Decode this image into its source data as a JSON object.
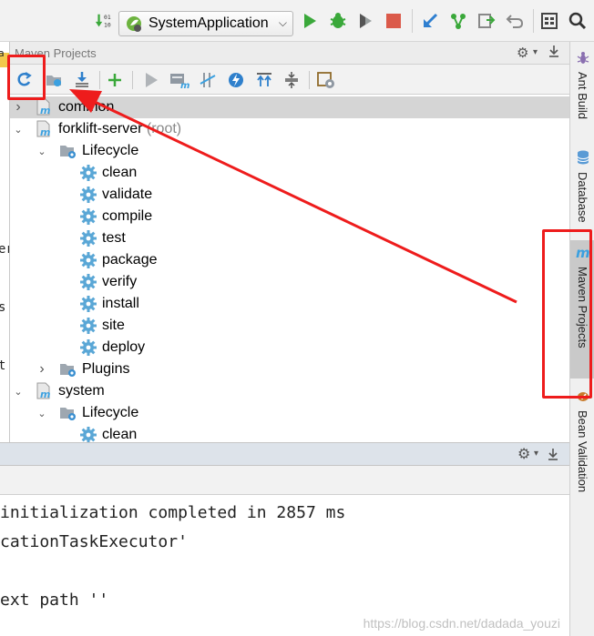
{
  "toolbar": {
    "run_config": "SystemApplication",
    "icons": [
      "sort-01-icon",
      "run-icon",
      "debug-icon",
      "coverage-icon",
      "stop-icon",
      "vcs-update-icon",
      "vcs-branch-icon",
      "vcs-compare-icon",
      "undo-icon",
      "project-structure-icon",
      "search-icon"
    ]
  },
  "left_edge": {
    "fragments": [
      "a",
      "er",
      "s",
      "t"
    ]
  },
  "maven": {
    "title": "Maven Projects",
    "toolbar_icons": [
      "reimport-icon",
      "generate-sources-icon",
      "download-icon",
      "add-icon",
      "run-maven-icon",
      "execute-goal-icon",
      "toggle-offline-icon",
      "skip-tests-icon",
      "show-dependencies-icon",
      "collapse-all-icon",
      "settings-icon"
    ],
    "tree": [
      {
        "label": "common",
        "suffix": "",
        "level": 0,
        "type": "module",
        "expanded": false,
        "selected": true
      },
      {
        "label": "forklift-server",
        "suffix": " (root)",
        "level": 0,
        "type": "module",
        "expanded": true,
        "selected": false
      },
      {
        "label": "Lifecycle",
        "suffix": "",
        "level": 1,
        "type": "folder",
        "expanded": true,
        "selected": false
      },
      {
        "label": "clean",
        "suffix": "",
        "level": 2,
        "type": "goal",
        "selected": false
      },
      {
        "label": "validate",
        "suffix": "",
        "level": 2,
        "type": "goal",
        "selected": false
      },
      {
        "label": "compile",
        "suffix": "",
        "level": 2,
        "type": "goal",
        "selected": false
      },
      {
        "label": "test",
        "suffix": "",
        "level": 2,
        "type": "goal",
        "selected": false
      },
      {
        "label": "package",
        "suffix": "",
        "level": 2,
        "type": "goal",
        "selected": false
      },
      {
        "label": "verify",
        "suffix": "",
        "level": 2,
        "type": "goal",
        "selected": false
      },
      {
        "label": "install",
        "suffix": "",
        "level": 2,
        "type": "goal",
        "selected": false
      },
      {
        "label": "site",
        "suffix": "",
        "level": 2,
        "type": "goal",
        "selected": false
      },
      {
        "label": "deploy",
        "suffix": "",
        "level": 2,
        "type": "goal",
        "selected": false
      },
      {
        "label": "Plugins",
        "suffix": "",
        "level": 1,
        "type": "folder",
        "expanded": false,
        "selected": false
      },
      {
        "label": "system",
        "suffix": "",
        "level": 0,
        "type": "module",
        "expanded": true,
        "selected": false
      },
      {
        "label": "Lifecycle",
        "suffix": "",
        "level": 1,
        "type": "folder",
        "expanded": true,
        "selected": false
      },
      {
        "label": "clean",
        "suffix": "",
        "level": 2,
        "type": "goal",
        "selected": false
      }
    ]
  },
  "right_stripe": {
    "tabs": [
      {
        "label": "Ant Build",
        "icon": "ant-icon",
        "active": false
      },
      {
        "label": "Database",
        "icon": "database-icon",
        "active": false
      },
      {
        "label": "Maven Projects",
        "icon": "maven-icon",
        "active": true
      },
      {
        "label": "Bean Validation",
        "icon": "bean-validation-icon",
        "active": false
      }
    ]
  },
  "console": {
    "lines": [
      "initialization completed in 2857 ms",
      "cationTaskExecutor'",
      "",
      "ext path ''"
    ]
  },
  "watermark": "https://blog.csdn.net/dadada_youzi",
  "colors": {
    "annotation": "#ee1c1c",
    "run_green": "#3aa83a",
    "stop_red": "#db5a4a",
    "maven_blue": "#3aa0e0",
    "gear_blue": "#5aa7d6"
  }
}
